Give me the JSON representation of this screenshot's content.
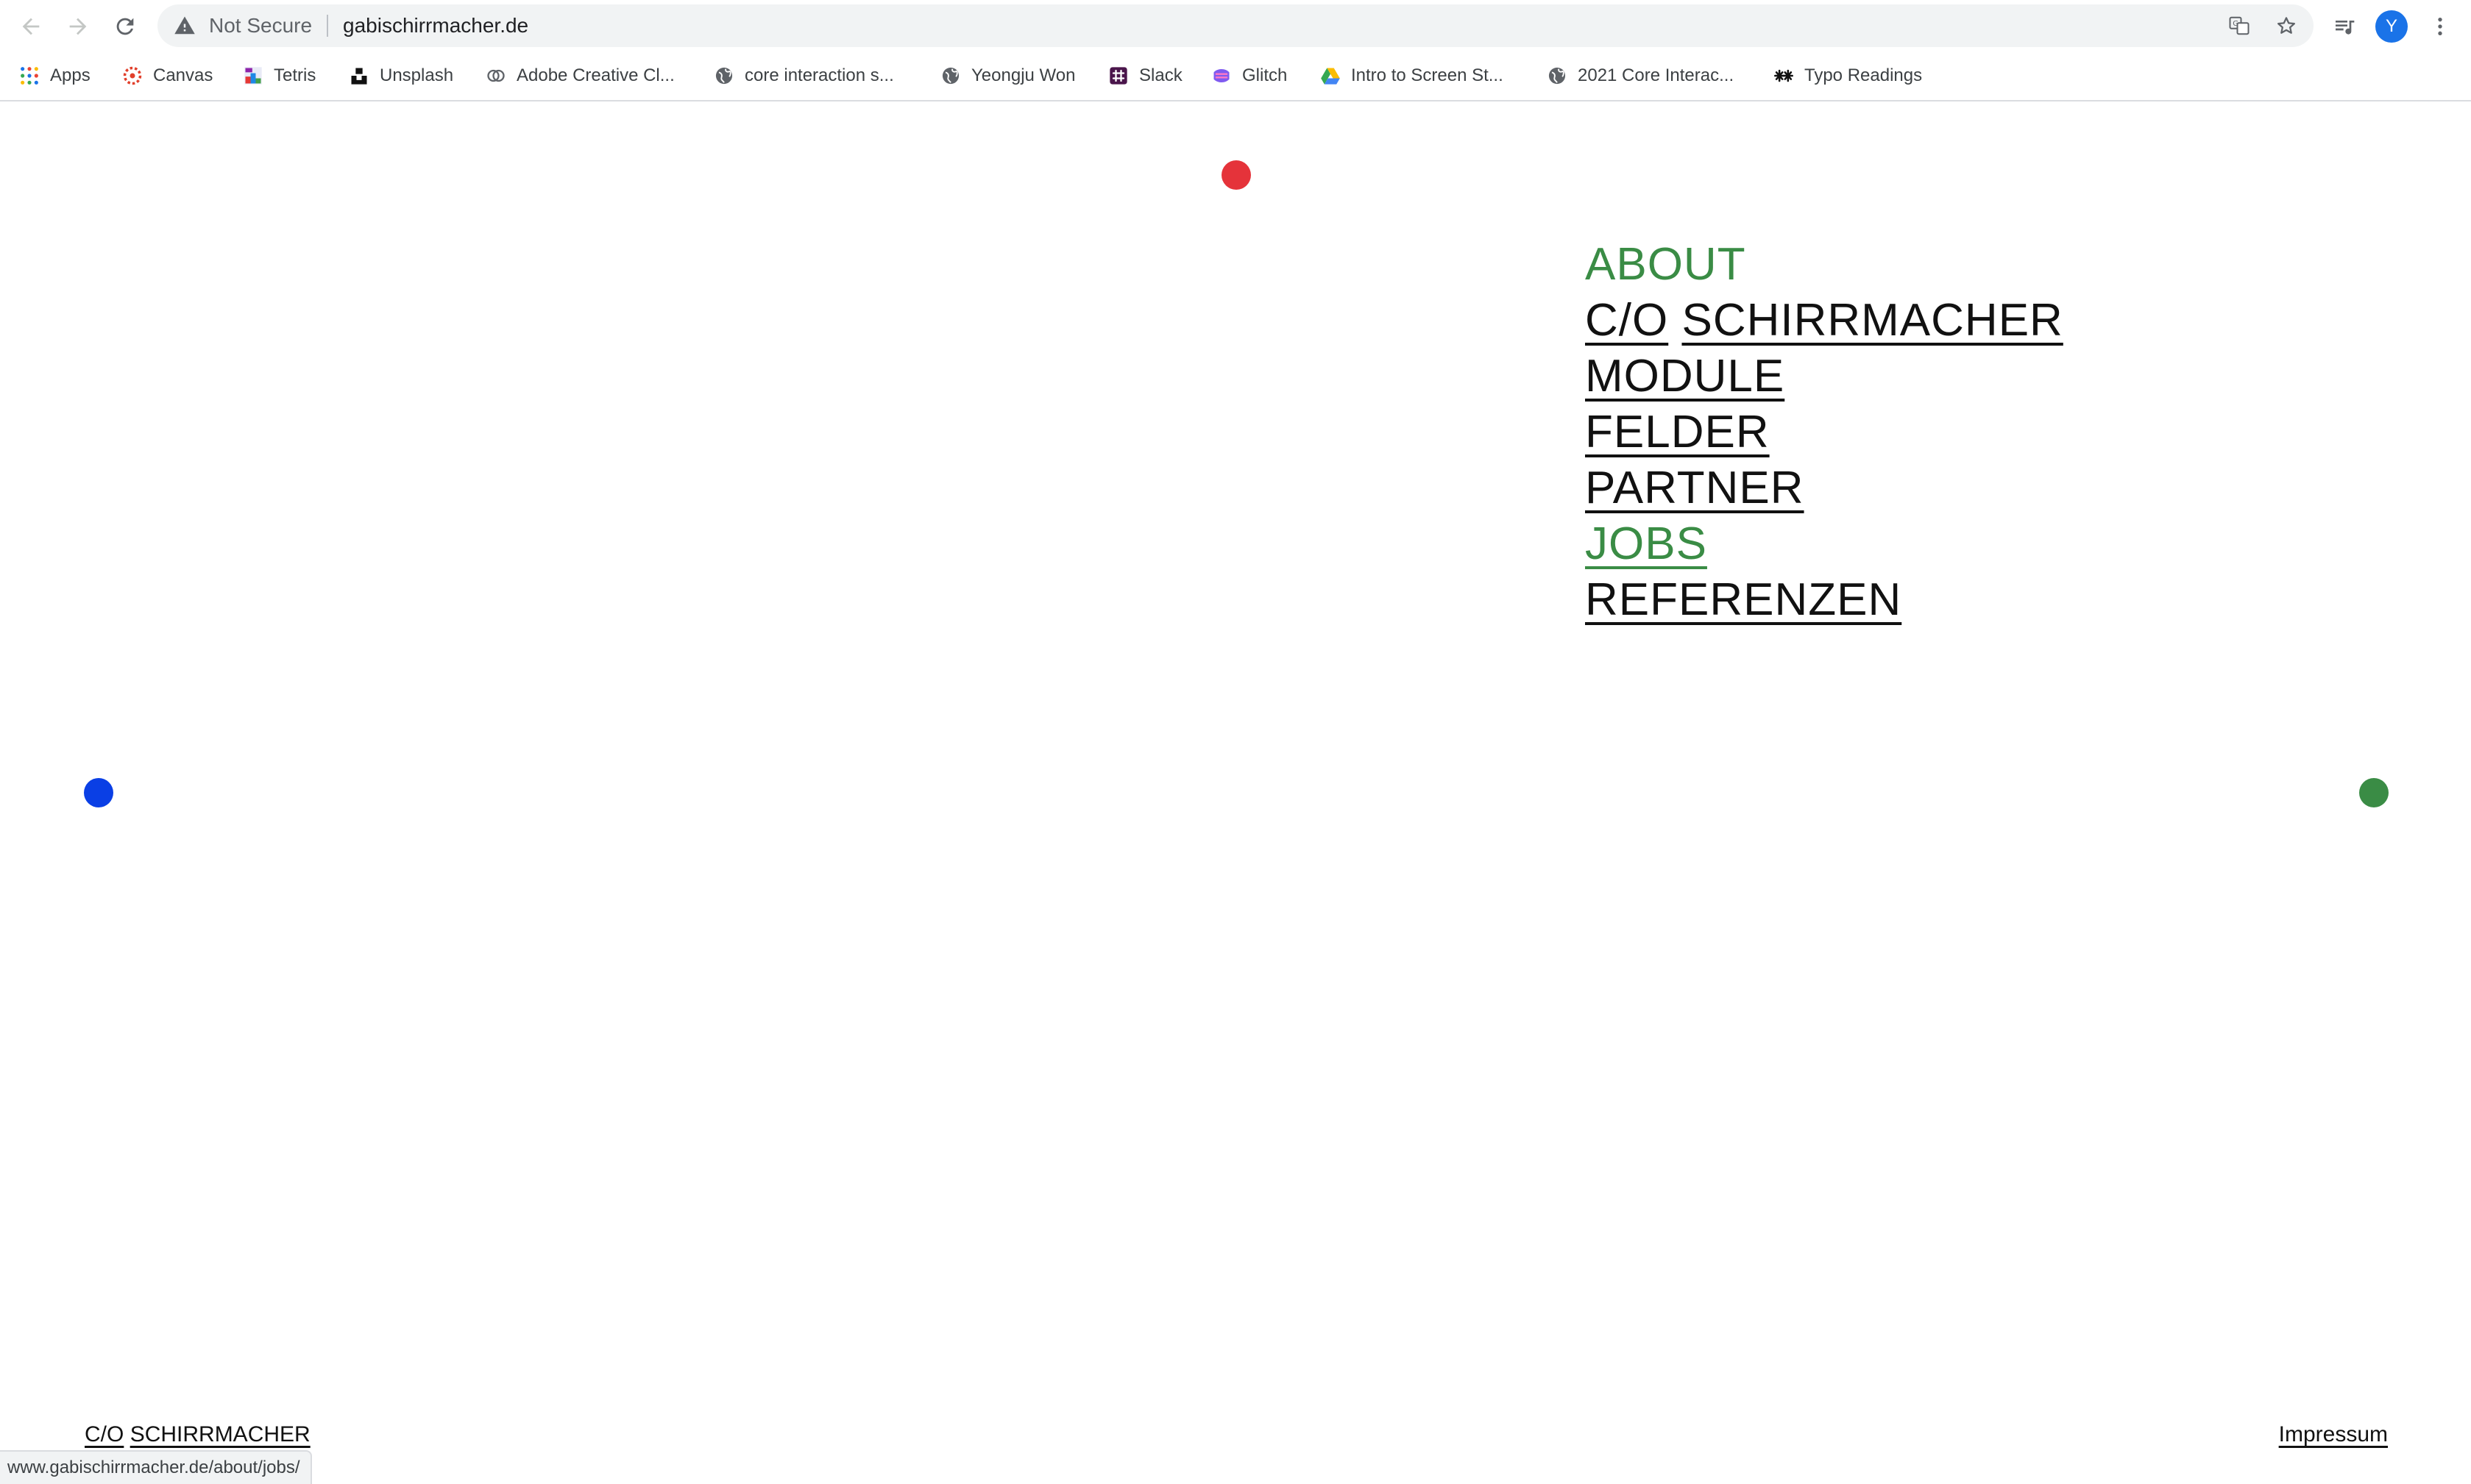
{
  "browser": {
    "not_secure_label": "Not Secure",
    "url": "gabischirrmacher.de",
    "avatar_initial": "Y",
    "bookmarks": [
      {
        "label": "Apps",
        "icon": "apps-grid-icon"
      },
      {
        "label": "Canvas",
        "icon": "canvas-icon"
      },
      {
        "label": "Tetris",
        "icon": "tetris-icon"
      },
      {
        "label": "Unsplash",
        "icon": "unsplash-icon"
      },
      {
        "label": "Adobe Creative Cl...",
        "icon": "adobe-cc-icon"
      },
      {
        "label": "core interaction s...",
        "icon": "globe-icon"
      },
      {
        "label": "Yeongju Won",
        "icon": "globe-icon"
      },
      {
        "label": "Slack",
        "icon": "slack-icon"
      },
      {
        "label": "Glitch",
        "icon": "glitch-icon"
      },
      {
        "label": "Intro to Screen St...",
        "icon": "google-drive-icon"
      },
      {
        "label": "2021 Core Interac...",
        "icon": "globe-icon"
      },
      {
        "label": "Typo Readings",
        "icon": "typo-icon"
      }
    ],
    "status_url": "www.gabischirrmacher.de/about/jobs/"
  },
  "page": {
    "menu": {
      "about": "ABOUT",
      "co": "C/O",
      "schirrmacher": "SCHIRRMACHER",
      "module": "MODULE",
      "felder": "FELDER",
      "partner": "PARTNER",
      "jobs": "JOBS",
      "referenzen": "REFERENZEN"
    },
    "footer": {
      "co": "C/O",
      "schirrmacher": "SCHIRRMACHER",
      "impressum": "Impressum"
    },
    "colors": {
      "green": "#3a8c45",
      "red": "#e5333a",
      "blue": "#0a3fe5",
      "text": "#111111"
    }
  }
}
